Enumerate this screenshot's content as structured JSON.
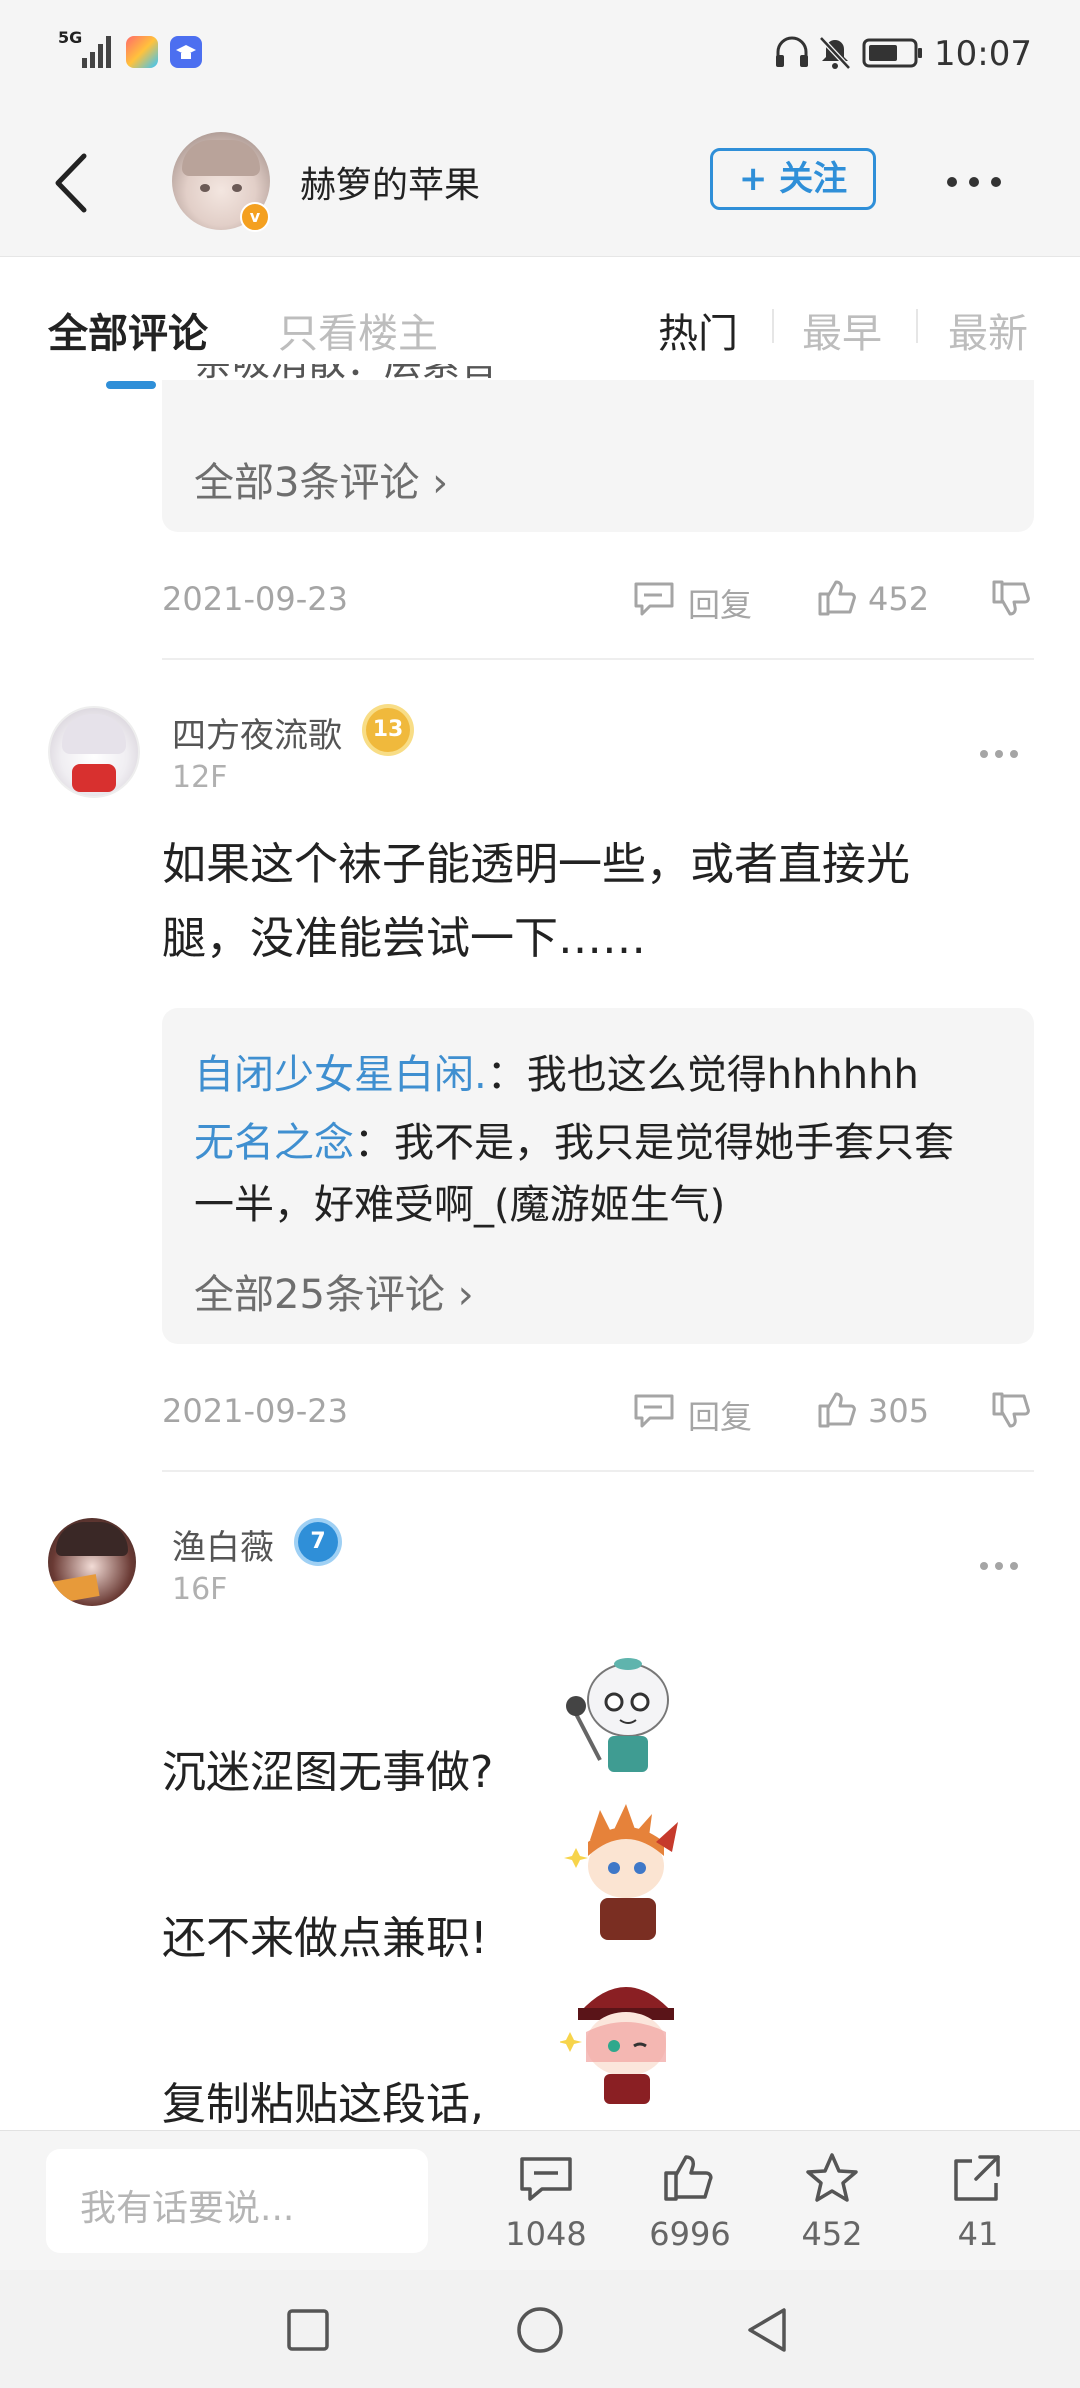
{
  "status": {
    "network": "5G",
    "time": "10:07"
  },
  "header": {
    "username": "赫箩的苹果",
    "follow_label": "+ 关注"
  },
  "tabs": {
    "all": "全部评论",
    "op_only": "只看楼主",
    "hot": "热门",
    "earliest": "最早",
    "newest": "最新"
  },
  "prev_comment": {
    "partial_text": "亲吸消散：层素言",
    "more": "全部3条评论",
    "date": "2021-09-23",
    "reply": "回复",
    "likes": "452"
  },
  "comment1": {
    "name": "四方夜流歌",
    "level": "13",
    "floor": "12F",
    "text_line1": "如果这个袜子能透明一些，或者直接光",
    "text_line2": "腿，没准能尝试一下……",
    "reply1_user": "自闭少女星白闲.",
    "reply1_text": "：我也这么觉得hhhhhh",
    "reply2_user": "无名之念",
    "reply2_text_line1": "：我不是，我只是觉得她手套只套",
    "reply2_text_line2": "一半，好难受啊_(魔游姬生气)",
    "more": "全部25条评论",
    "date": "2021-09-23",
    "reply": "回复",
    "likes": "305"
  },
  "comment2": {
    "name": "渔白薇",
    "level": "7",
    "floor": "16F",
    "line1": "沉迷涩图无事做?",
    "line2": "还不来做点兼职!",
    "line3": "复制粘贴这段话,"
  },
  "bottom": {
    "input_placeholder": "我有话要说...",
    "comments": "1048",
    "likes": "6996",
    "favorites": "452",
    "shares": "41"
  },
  "colors": {
    "accent": "#2f8fd8",
    "link": "#3f8fd0",
    "gold": "#e7b53c"
  }
}
